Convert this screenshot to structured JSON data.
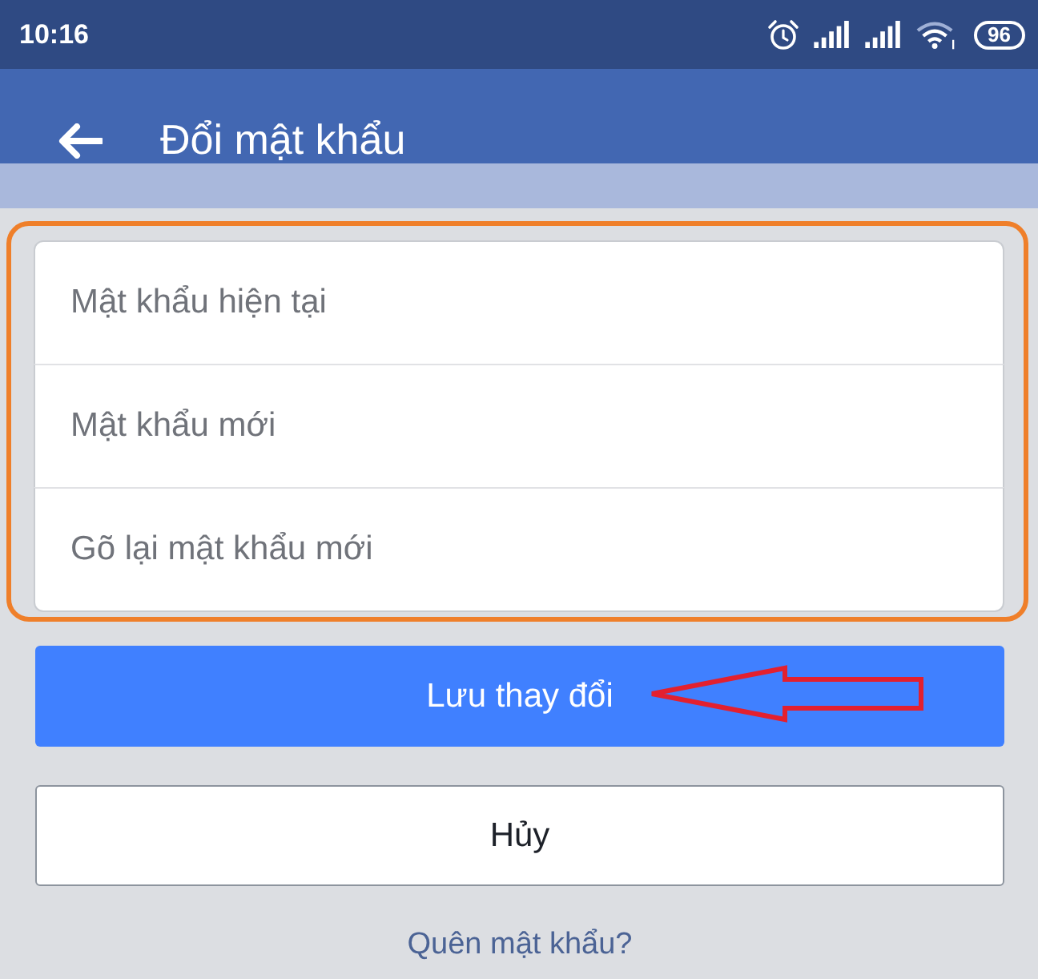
{
  "status_bar": {
    "time": "10:16",
    "battery": "96"
  },
  "header": {
    "title": "Đổi mật khẩu"
  },
  "form": {
    "outlined": true,
    "fields": [
      {
        "placeholder": "Mật khẩu hiện tại"
      },
      {
        "placeholder": "Mật khẩu mới"
      },
      {
        "placeholder": "Gõ lại mật khẩu mới"
      }
    ]
  },
  "buttons": [
    {
      "label": "Lưu thay đổi",
      "kind": "primary",
      "pointed": true
    },
    {
      "label": "Hủy",
      "kind": "secondary",
      "pointed": false
    }
  ],
  "link": "Quên mật khẩu?"
}
